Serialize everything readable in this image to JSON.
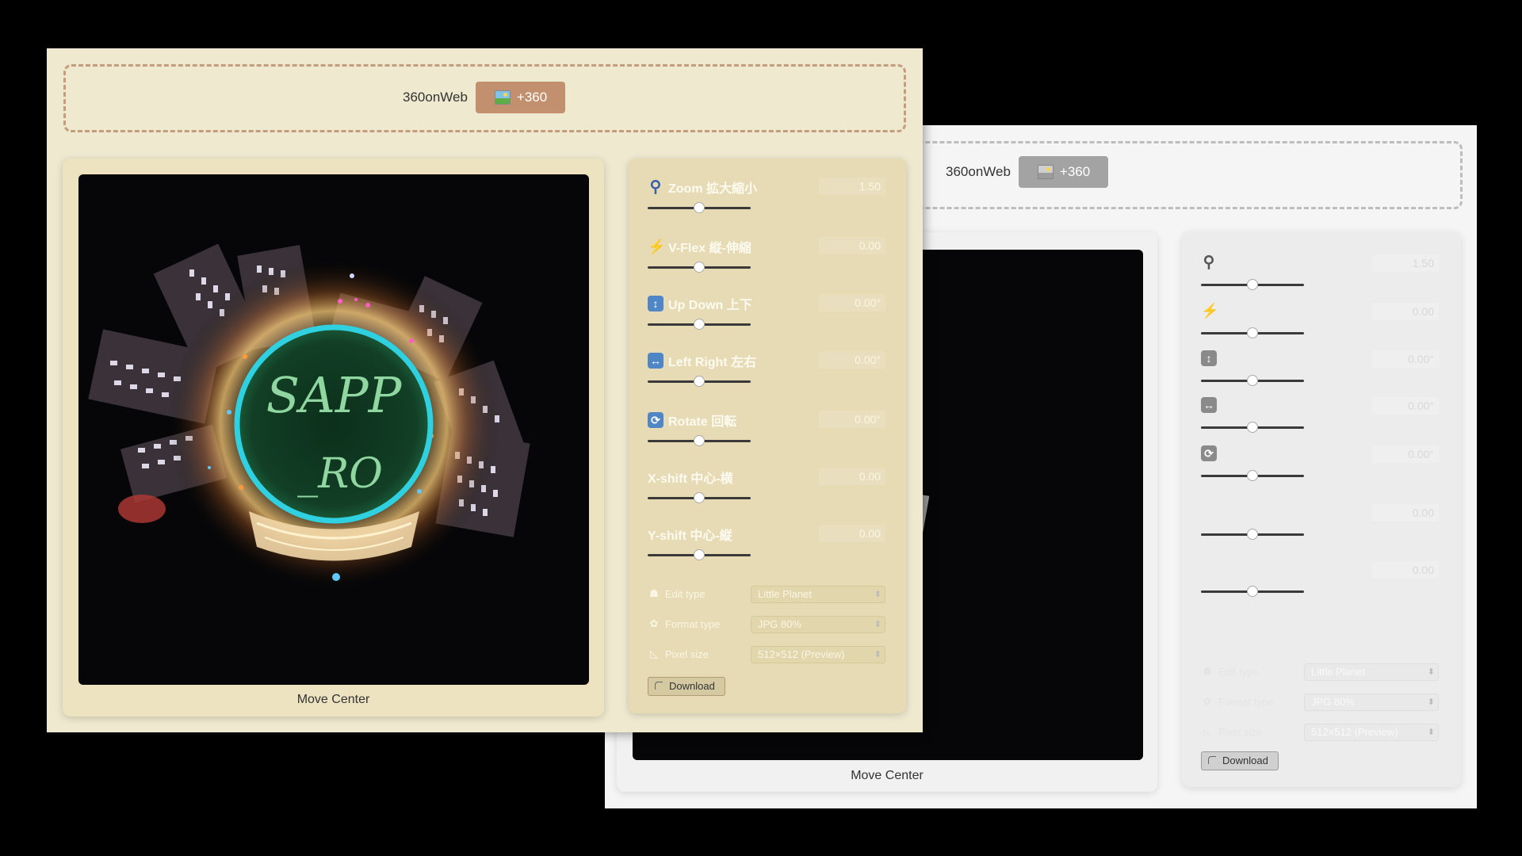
{
  "app": {
    "brand": "360onWeb",
    "add_button_label": "+360"
  },
  "viewer": {
    "caption": "Move Center",
    "planet_text_1": "SAPP",
    "planet_text_2": "_RO"
  },
  "controls": {
    "sliders": [
      {
        "key": "zoom",
        "label": "Zoom 拡大縮小",
        "value": "1.50",
        "icon": "zoom-icon",
        "level": 0.5
      },
      {
        "key": "vflex",
        "label": "V-Flex 縦-伸縮",
        "value": "0.00",
        "icon": "lightning-icon",
        "level": 0.5
      },
      {
        "key": "updown",
        "label": "Up Down 上下",
        "value": "0.00°",
        "icon": "up-down-arrow-icon",
        "level": 0.5
      },
      {
        "key": "leftright",
        "label": "Left Right 左右",
        "value": "0.00°",
        "icon": "left-right-arrow-icon",
        "level": 0.5
      },
      {
        "key": "rotate",
        "label": "Rotate 回転",
        "value": "0.00°",
        "icon": "rotate-icon",
        "level": 0.5
      },
      {
        "key": "xshift",
        "label": "X-shift 中心-横",
        "value": "0.00",
        "icon": "",
        "level": 0.5
      },
      {
        "key": "yshift",
        "label": "Y-shift 中心-縦",
        "value": "0.00",
        "icon": "",
        "level": 0.5
      }
    ],
    "back_values": [
      "1.50",
      "0.00",
      "0.00°",
      "0.00°",
      "0.00°",
      "0.00",
      "0.00"
    ],
    "selects": [
      {
        "label": "Edit type",
        "value": "Little Planet",
        "icon": "edit-type-icon"
      },
      {
        "label": "Format type",
        "value": "JPG 80%",
        "icon": "palette-icon"
      },
      {
        "label": "Pixel size",
        "value": "512×512 (Preview)",
        "icon": "triangle-ruler-icon"
      }
    ],
    "download_label": "Download"
  },
  "colors": {
    "front_background": "#efe9cf",
    "front_accent": "#c2906e",
    "back_background": "#f5f5f5",
    "back_accent": "#a3a3a3"
  }
}
